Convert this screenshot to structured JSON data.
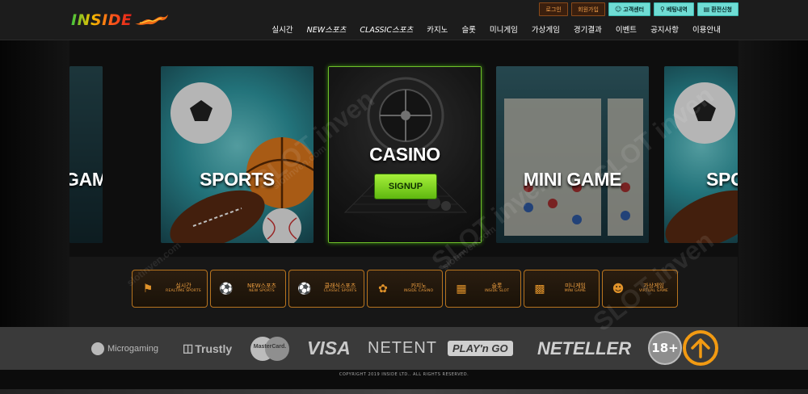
{
  "header": {
    "logo_text": "INSIDE",
    "top_buttons": [
      {
        "label": "로그인"
      },
      {
        "label": "회원가입"
      },
      {
        "label": "고객센터",
        "icon": "person-icon"
      },
      {
        "label": "베팅내역",
        "icon": "search-icon"
      },
      {
        "label": "환전신청",
        "icon": "document-icon"
      }
    ],
    "nav": [
      "실시간",
      "NEW스포츠",
      "CLASSIC스포츠",
      "카지노",
      "슬롯",
      "미니게임",
      "가상게임",
      "경기결과",
      "이벤트",
      "공지사항",
      "이용안내"
    ]
  },
  "carousel": {
    "cards": [
      {
        "label": "GAME"
      },
      {
        "label": "SPORTS"
      },
      {
        "label": "CASINO"
      },
      {
        "label": "MINI GAME"
      },
      {
        "label": "SPO"
      }
    ],
    "signup_label": "SIGNUP"
  },
  "categories": [
    {
      "ko": "실시간",
      "en": "REALTIME SPORTS",
      "icon": "live-sports-icon"
    },
    {
      "ko": "NEW스포츠",
      "en": "NEW SPORTS",
      "icon": "new-sports-icon"
    },
    {
      "ko": "클래식스포츠",
      "en": "CLASSIC SPORTS",
      "icon": "soccer-ball-icon"
    },
    {
      "ko": "카지노",
      "en": "INSIDE CASINO",
      "icon": "casino-chip-icon"
    },
    {
      "ko": "슬롯",
      "en": "INSIDE SLOT",
      "icon": "slot-machine-icon"
    },
    {
      "ko": "미니게임",
      "en": "MINI GAME",
      "icon": "mini-game-icon"
    },
    {
      "ko": "가상게임",
      "en": "VIRTUAL GAME",
      "icon": "virtual-game-icon"
    }
  ],
  "partners": [
    "Microgaming",
    "Trustly",
    "MasterCard.",
    "VISA",
    "NETENT",
    "PLAY'n GO",
    "NETELLER"
  ],
  "badge_18": "18+",
  "copyright": "COPYRIGHT 2019 INSIDE LTD.. ALL RIGHTS RESERVED.",
  "watermark": [
    "SLOT inven",
    "slotinven.com"
  ],
  "colors": {
    "accent_orange": "#f29a12",
    "signup_green": "#7ad420",
    "teal_button": "#6fdcd4"
  }
}
